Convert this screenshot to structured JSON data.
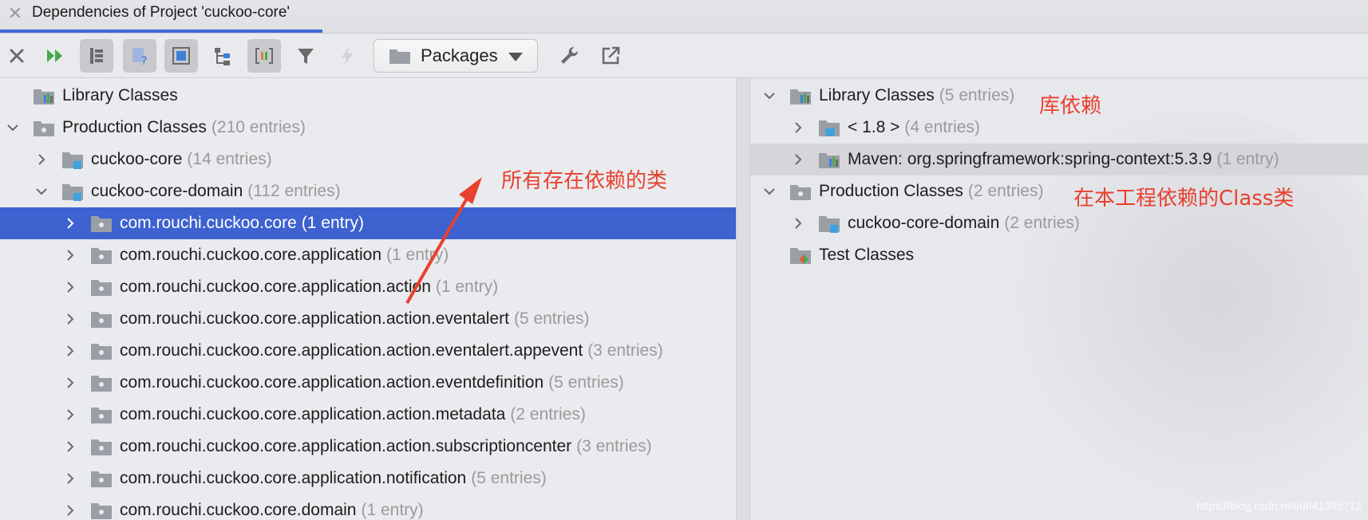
{
  "window": {
    "title": "Dependencies of Project 'cuckoo-core'"
  },
  "toolbar": {
    "scope_label": "Packages"
  },
  "left_tree": [
    {
      "label": "Library Classes",
      "count": "",
      "indent": 0,
      "chevron": "none",
      "icon": "library"
    },
    {
      "label": "Production Classes",
      "count": "(210 entries)",
      "indent": 0,
      "chevron": "down",
      "icon": "folder"
    },
    {
      "label": "cuckoo-core",
      "count": "(14 entries)",
      "indent": 1,
      "chevron": "right",
      "icon": "module"
    },
    {
      "label": "cuckoo-core-domain",
      "count": "(112 entries)",
      "indent": 1,
      "chevron": "down",
      "icon": "module"
    },
    {
      "label": "com.rouchi.cuckoo.core",
      "count": "(1 entry)",
      "indent": 2,
      "chevron": "right",
      "icon": "package",
      "selected": true
    },
    {
      "label": "com.rouchi.cuckoo.core.application",
      "count": "(1 entry)",
      "indent": 2,
      "chevron": "right",
      "icon": "package"
    },
    {
      "label": "com.rouchi.cuckoo.core.application.action",
      "count": "(1 entry)",
      "indent": 2,
      "chevron": "right",
      "icon": "package"
    },
    {
      "label": "com.rouchi.cuckoo.core.application.action.eventalert",
      "count": "(5 entries)",
      "indent": 2,
      "chevron": "right",
      "icon": "package"
    },
    {
      "label": "com.rouchi.cuckoo.core.application.action.eventalert.appevent",
      "count": "(3 entries)",
      "indent": 2,
      "chevron": "right",
      "icon": "package"
    },
    {
      "label": "com.rouchi.cuckoo.core.application.action.eventdefinition",
      "count": "(5 entries)",
      "indent": 2,
      "chevron": "right",
      "icon": "package"
    },
    {
      "label": "com.rouchi.cuckoo.core.application.action.metadata",
      "count": "(2 entries)",
      "indent": 2,
      "chevron": "right",
      "icon": "package"
    },
    {
      "label": "com.rouchi.cuckoo.core.application.action.subscriptioncenter",
      "count": "(3 entries)",
      "indent": 2,
      "chevron": "right",
      "icon": "package"
    },
    {
      "label": "com.rouchi.cuckoo.core.application.notification",
      "count": "(5 entries)",
      "indent": 2,
      "chevron": "right",
      "icon": "package"
    },
    {
      "label": "com.rouchi.cuckoo.core.domain",
      "count": "(1 entry)",
      "indent": 2,
      "chevron": "right",
      "icon": "package"
    }
  ],
  "right_tree": [
    {
      "label": "Library Classes",
      "count": "(5 entries)",
      "indent": 0,
      "chevron": "down",
      "icon": "library"
    },
    {
      "label": "< 1.8 >",
      "count": "(4 entries)",
      "indent": 1,
      "chevron": "right",
      "icon": "jdk"
    },
    {
      "label": "Maven: org.springframework:spring-context:5.3.9",
      "count": "(1 entry)",
      "indent": 1,
      "chevron": "right",
      "icon": "library",
      "highlight": true
    },
    {
      "label": "Production Classes",
      "count": "(2 entries)",
      "indent": 0,
      "chevron": "down",
      "icon": "folder"
    },
    {
      "label": "cuckoo-core-domain",
      "count": "(2 entries)",
      "indent": 1,
      "chevron": "right",
      "icon": "module"
    },
    {
      "label": "Test Classes",
      "count": "",
      "indent": 0,
      "chevron": "none",
      "icon": "test"
    }
  ],
  "annotations": {
    "all_dependent_classes": "所有存在依赖的类",
    "library_dependency": "库依赖",
    "project_dependency": "在本工程依赖的Class类"
  },
  "watermark": "https://blog.csdn.net/u641385712",
  "colors": {
    "selection": "#3e62d0",
    "annotation": "#e8412e",
    "tab_accent": "#3e6bd6"
  }
}
